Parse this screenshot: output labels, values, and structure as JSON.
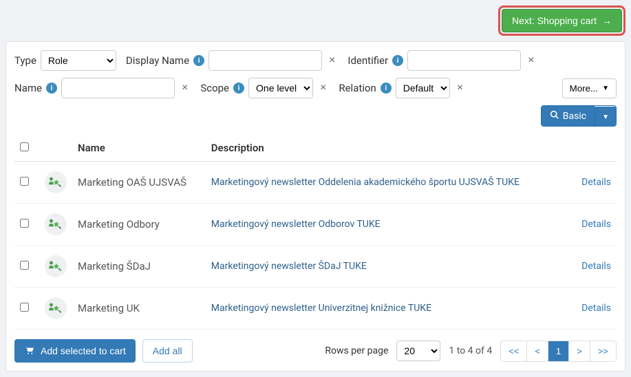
{
  "header": {
    "next_label": "Next: Shopping cart"
  },
  "filters": {
    "type_label": "Type",
    "type_value": "Role",
    "display_name_label": "Display Name",
    "display_name_value": "",
    "identifier_label": "Identifier",
    "identifier_value": "",
    "name_label": "Name",
    "name_value": "",
    "scope_label": "Scope",
    "scope_value": "One level",
    "relation_label": "Relation",
    "relation_value": "Default",
    "more_label": "More...",
    "basic_label": "Basic"
  },
  "table": {
    "col_name": "Name",
    "col_desc": "Description",
    "details_label": "Details",
    "rows": [
      {
        "name": "Marketing OAŠ UJSVAŠ",
        "desc": "Marketingový newsletter Oddelenia akademického športu UJSVAŠ TUKE"
      },
      {
        "name": "Marketing Odbory",
        "desc": "Marketingový newsletter Odborov TUKE"
      },
      {
        "name": "Marketing ŠDaJ",
        "desc": "Marketingový newsletter ŠDaJ TUKE"
      },
      {
        "name": "Marketing UK",
        "desc": "Marketingový newsletter Univerzitnej knižnice TUKE"
      }
    ]
  },
  "footer": {
    "add_selected": "Add selected to cart",
    "add_all": "Add all",
    "rows_per_page": "Rows per page",
    "rows_value": "20",
    "counter": "1 to 4 of 4",
    "pg_first": "<<",
    "pg_prev": "<",
    "pg_current": "1",
    "pg_next": ">",
    "pg_last": ">>"
  }
}
